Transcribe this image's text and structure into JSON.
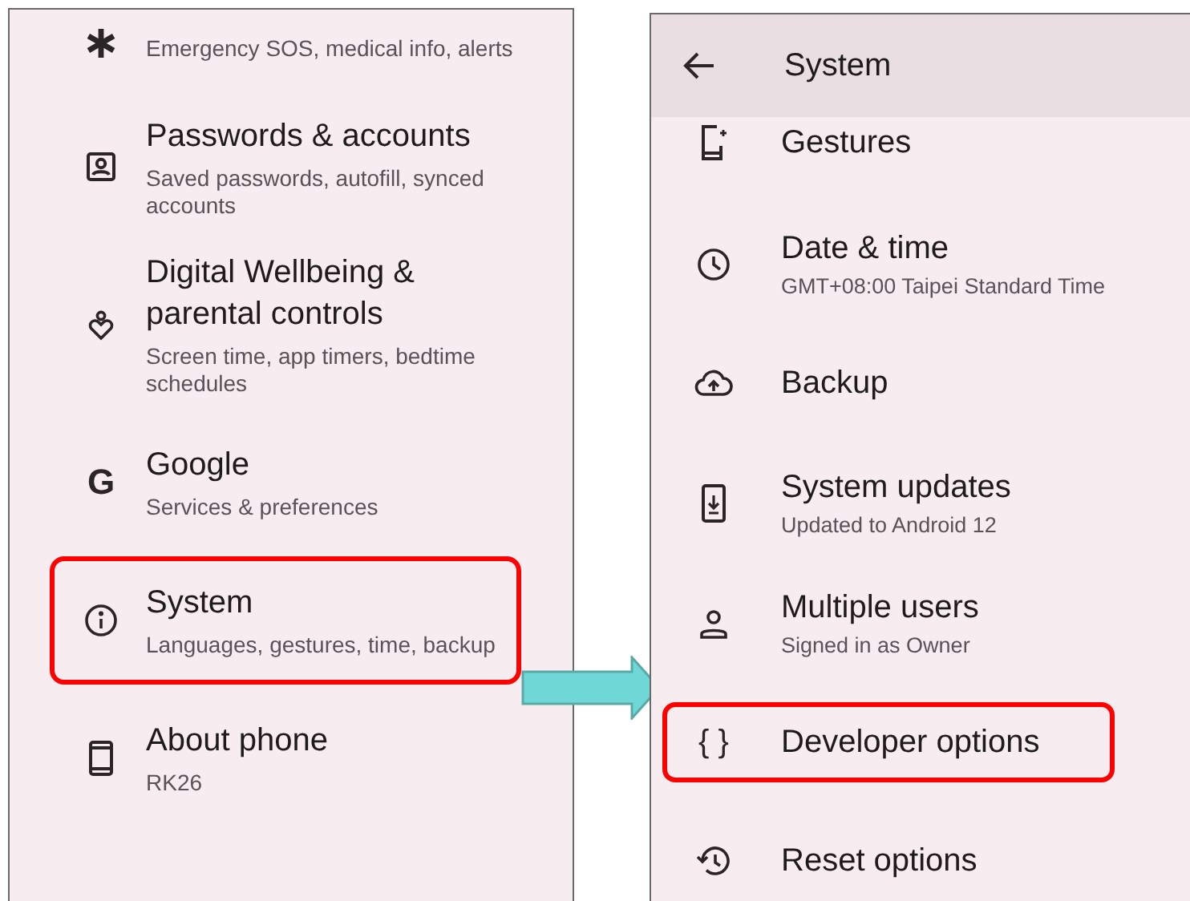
{
  "settings_screen": {
    "items": [
      {
        "subtitle": "Emergency SOS, medical info, alerts",
        "highlighted": false
      },
      {
        "title": "Passwords & accounts",
        "subtitle": "Saved passwords, autofill, synced accounts",
        "highlighted": false
      },
      {
        "title": "Digital Wellbeing & parental controls",
        "subtitle": "Screen time, app timers, bedtime schedules",
        "highlighted": false
      },
      {
        "title": "Google",
        "subtitle": "Services & preferences",
        "highlighted": false,
        "icon_glyph": "G"
      },
      {
        "title": "System",
        "subtitle": "Languages, gestures, time, backup",
        "highlighted": true
      },
      {
        "title": "About phone",
        "subtitle": "RK26",
        "highlighted": false
      }
    ]
  },
  "system_screen": {
    "title": "System",
    "items": [
      {
        "title": "Gestures",
        "highlighted": false
      },
      {
        "title": "Date & time",
        "subtitle": "GMT+08:00 Taipei Standard Time",
        "highlighted": false
      },
      {
        "title": "Backup",
        "highlighted": false
      },
      {
        "title": "System updates",
        "subtitle": "Updated to Android 12",
        "highlighted": false
      },
      {
        "title": "Multiple users",
        "subtitle": "Signed in as Owner",
        "highlighted": false
      },
      {
        "title": "Developer options",
        "highlighted": true,
        "icon_glyph": "{ }"
      },
      {
        "title": "Reset options",
        "highlighted": false
      }
    ]
  }
}
